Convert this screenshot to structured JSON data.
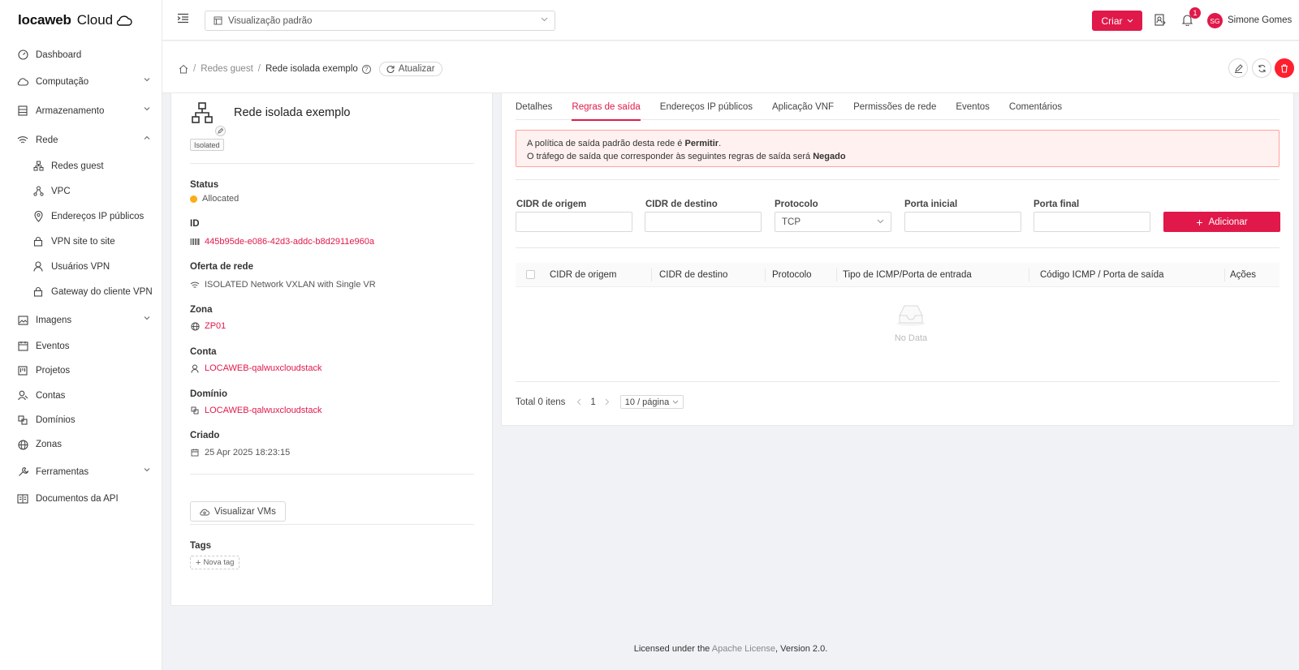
{
  "brand": {
    "name_bold": "locaweb",
    "name_light": "Cloud"
  },
  "sidebar": {
    "items": [
      {
        "label": "Dashboard",
        "icon": "dashboard-icon"
      },
      {
        "label": "Computação",
        "icon": "cloud-icon"
      },
      {
        "label": "Armazenamento",
        "icon": "database-icon"
      },
      {
        "label": "Rede",
        "icon": "wifi-icon"
      },
      {
        "label": "Imagens",
        "icon": "picture-icon"
      },
      {
        "label": "Eventos",
        "icon": "calendar-icon"
      },
      {
        "label": "Projetos",
        "icon": "project-icon"
      },
      {
        "label": "Contas",
        "icon": "user-icon"
      },
      {
        "label": "Domínios",
        "icon": "block-icon"
      },
      {
        "label": "Zonas",
        "icon": "global-icon"
      },
      {
        "label": "Ferramentas",
        "icon": "tool-icon"
      },
      {
        "label": "Documentos da API",
        "icon": "read-icon"
      }
    ],
    "rede_sub": [
      {
        "label": "Redes guest",
        "icon": "apartment-icon"
      },
      {
        "label": "VPC",
        "icon": "deployment-unit-icon"
      },
      {
        "label": "Endereços IP públicos",
        "icon": "environment-icon"
      },
      {
        "label": "VPN site to site",
        "icon": "lock-icon"
      },
      {
        "label": "Usuários VPN",
        "icon": "user-icon"
      },
      {
        "label": "Gateway do cliente VPN",
        "icon": "lock-icon"
      }
    ]
  },
  "topbar": {
    "view_select": "Visualização padrão",
    "create_label": "Criar",
    "notification_count": "1",
    "user_initials": "SG",
    "user_name": "Simone Gomes"
  },
  "breadcrumb": {
    "parent": "Redes guest",
    "current": "Rede isolada exemplo",
    "refresh": "Atualizar"
  },
  "network": {
    "name": "Rede isolada exemplo",
    "type": "Isolated",
    "fields": [
      {
        "label": "Status",
        "value": "Allocated"
      },
      {
        "label": "ID",
        "value": "445b95de-e086-42d3-addc-b8d2911e960a"
      },
      {
        "label": "Oferta de rede",
        "value": "ISOLATED Network VXLAN with Single VR"
      },
      {
        "label": "Zona",
        "value": "ZP01"
      },
      {
        "label": "Conta",
        "value": "LOCAWEB-qalwuxcloudstack"
      },
      {
        "label": "Domínio",
        "value": "LOCAWEB-qalwuxcloudstack"
      },
      {
        "label": "Criado",
        "value": "25 Apr 2025 18:23:15"
      }
    ],
    "view_vms": "Visualizar VMs",
    "tags_label": "Tags",
    "new_tag": "Nova tag"
  },
  "tabs": [
    "Detalhes",
    "Regras de saída",
    "Endereços IP públicos",
    "Aplicação VNF",
    "Permissões de rede",
    "Eventos",
    "Comentários"
  ],
  "alert": {
    "line1_prefix": "A política de saída padrão desta rede é ",
    "line1_bold": "Permitir",
    "line1_suffix": ".",
    "line2_prefix": "O tráfego de saída que corresponder às seguintes regras de saída será ",
    "line2_bold": "Negado"
  },
  "form": {
    "source_cidr": "CIDR de origem",
    "dest_cidr": "CIDR de destino",
    "protocol": "Protocolo",
    "protocol_value": "TCP",
    "start_port": "Porta inicial",
    "end_port": "Porta final",
    "add": "Adicionar"
  },
  "table": {
    "columns": [
      "CIDR de origem",
      "CIDR de destino",
      "Protocolo",
      "Tipo de ICMP/Porta de entrada",
      "Código ICMP / Porta de saída",
      "Ações"
    ],
    "empty": "No Data"
  },
  "pagination": {
    "total": "Total 0 itens",
    "page": "1",
    "page_size": "10 / página"
  },
  "footer": {
    "prefix": "Licensed under the ",
    "link": "Apache License",
    "suffix": ", Version 2.0."
  },
  "colors": {
    "accent": "#e0194a",
    "status_allocated": "#faad14",
    "danger": "#ff1f2d"
  }
}
